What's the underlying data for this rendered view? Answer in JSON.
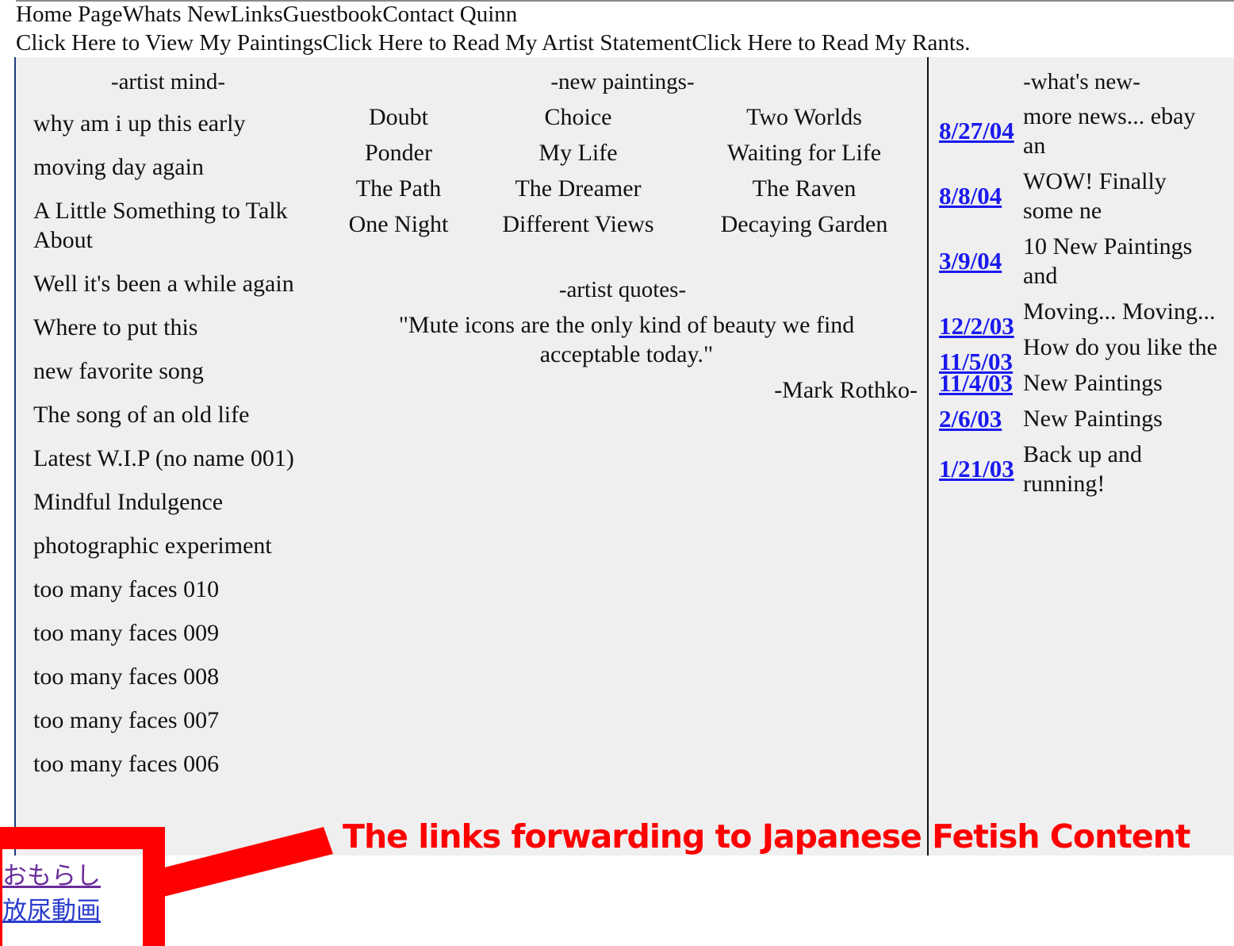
{
  "nav": {
    "row1": [
      "Home Page",
      "Whats New",
      "Links",
      "Guestbook",
      "Contact Quinn"
    ],
    "row2": [
      "Click Here to View My Paintings",
      "Click Here to Read My Artist Statement",
      "Click Here to Read My Rants."
    ]
  },
  "artist_mind": {
    "heading": "-artist mind-",
    "items": [
      "why am i up this early",
      "moving day again",
      "A Little Something to Talk About",
      "Well it's been a while again",
      "Where to put this",
      "new favorite song",
      "The song of an old life",
      "Latest W.I.P (no name 001)",
      "Mindful Indulgence",
      "photographic experiment",
      "too many faces 010",
      "too many faces 009",
      "too many faces 008",
      "too many faces 007",
      "too many faces 006"
    ]
  },
  "new_paintings": {
    "heading": "-new paintings-",
    "rows": [
      [
        "Doubt",
        "Choice",
        "Two Worlds"
      ],
      [
        "Ponder",
        "My Life",
        "Waiting for Life"
      ],
      [
        "The Path",
        "The Dreamer",
        "The Raven"
      ],
      [
        "One Night",
        "Different Views",
        "Decaying Garden"
      ]
    ]
  },
  "artist_quotes": {
    "heading": "-artist quotes-",
    "quote": "\"Mute icons are the only kind of beauty we find acceptable today.\"",
    "author": "-Mark Rothko-"
  },
  "whats_new": {
    "heading": "-what's new-",
    "items": [
      {
        "date": "8/27/04",
        "text": "more news... ebay an"
      },
      {
        "date": "8/8/04",
        "text": "WOW! Finally some ne"
      },
      {
        "date": "3/9/04",
        "text": "10 New Paintings and"
      },
      {
        "date": "12/2/03",
        "text": "Moving... Moving..."
      },
      {
        "date": "11/5/03",
        "text": "How do you like the"
      },
      {
        "date": "11/4/03",
        "text": "New Paintings"
      },
      {
        "date": "2/6/03",
        "text": "New Paintings"
      },
      {
        "date": "1/21/03",
        "text": "Back up and running!"
      }
    ]
  },
  "hidden_links": [
    "おもらし",
    "放尿動画"
  ],
  "annotation": {
    "text": "The links forwarding to Japanese Fetish Content",
    "color": "#ff0000"
  }
}
